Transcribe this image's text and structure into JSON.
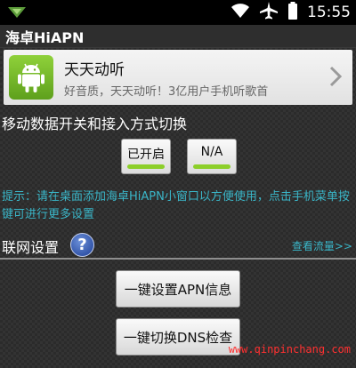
{
  "status_bar": {
    "time": "15:55"
  },
  "title_bar": {
    "title": "海卓HiAPN"
  },
  "banner": {
    "app_title": "天天动听",
    "app_desc": "好音质，天天动听！3亿用户手机听歌首"
  },
  "mobile_data": {
    "section_title": "移动数据开关和接入方式切换",
    "toggle_on_label": "已开启",
    "toggle_mode_label": "N/A",
    "hint_text": "提示：请在桌面添加海卓HiAPN小窗口以方便使用，点击手机菜单按键可进行更多设置"
  },
  "network": {
    "section_title": "联网设置",
    "help_label": "?",
    "traffic_link": "查看流量>>"
  },
  "actions": {
    "apn_button": "一键设置APN信息",
    "dns_button": "一键切换DNS检查"
  },
  "watermark": "www.qinpinchang.com",
  "colors": {
    "accent_cyan": "#3ab6c8",
    "toggle_green": "#8ccf2a",
    "status_bar_bg": "#000000"
  },
  "icons": {
    "status_left": "notification-triangle-icon",
    "wifi": "wifi-icon",
    "airplane": "airplane-icon",
    "battery": "battery-icon",
    "app": "android-icon",
    "chevron": "chevron-right-icon",
    "help": "help-icon"
  }
}
